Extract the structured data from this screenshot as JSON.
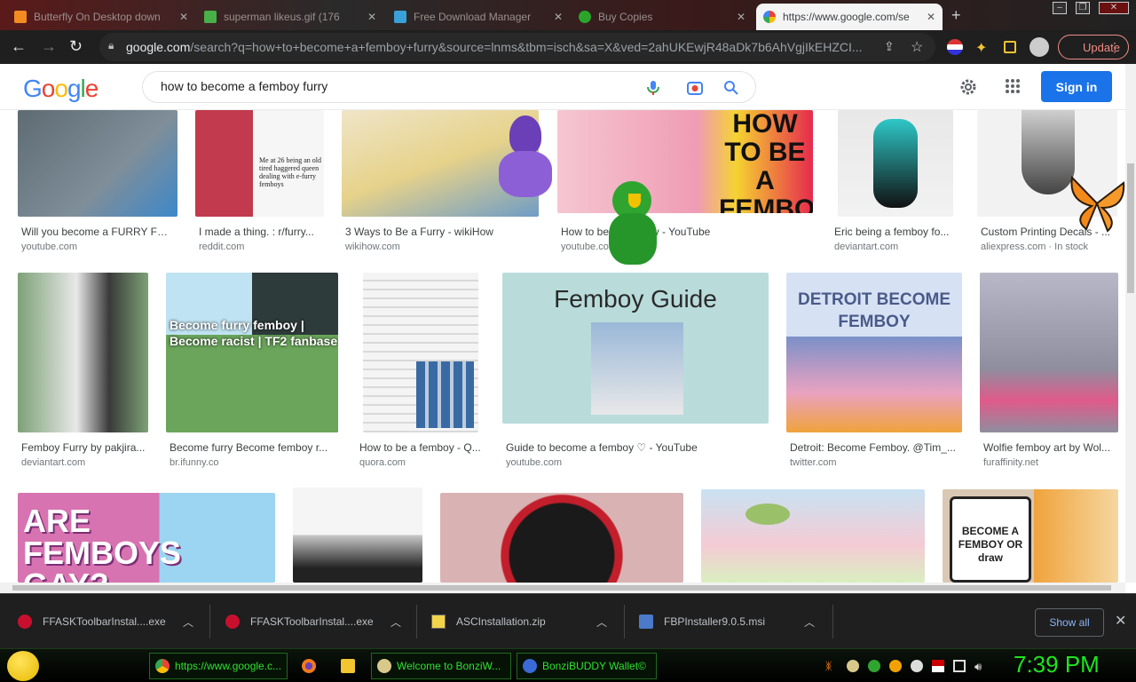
{
  "browser": {
    "tabs": [
      {
        "label": "Butterfly On Desktop down",
        "active": false
      },
      {
        "label": "superman likeus.gif (176",
        "active": false
      },
      {
        "label": "Free Download Manager",
        "active": false
      },
      {
        "label": "Buy Copies",
        "active": false
      },
      {
        "label": "https://www.google.com/se",
        "active": true
      }
    ],
    "url_host": "google.com",
    "url_rest": "/search?q=how+to+become+a+femboy+furry&source=lnms&tbm=isch&sa=X&ved=2ahUKEwjR48aDk7b6AhVgjIkEHZCI...",
    "update_label": "Update"
  },
  "google": {
    "logo": "Google",
    "query": "how to become a femboy furry",
    "sign_in": "Sign in"
  },
  "results": [
    {
      "title": "Will you become a FURRY FE...",
      "source": "youtube.com",
      "colors": [
        "#3d88c9",
        "#7f8e99"
      ]
    },
    {
      "title": "I made a thing. : r/furry...",
      "source": "reddit.com",
      "caption": "Me at 26 being an old tired haggered queen dealing with e-furry femboys",
      "colors": [
        "#c23a4d",
        "#f6f6f6"
      ]
    },
    {
      "title": "3 Ways to Be a Furry - wikiHow",
      "source": "wikihow.com",
      "colors": [
        "#e6d28a",
        "#6f9cc6"
      ]
    },
    {
      "title": "How to be a Femboy - YouTube",
      "source": "youtube.com",
      "caption": "HOW TO BE A FEMBOY",
      "colors": [
        "#ef9cb4",
        "#f5d331"
      ]
    },
    {
      "title": "Eric being a femboy fo...",
      "source": "deviantart.com",
      "colors": [
        "#e8e8e8",
        "#2ec7c7"
      ]
    },
    {
      "title": "Custom Printing Decals - ...",
      "source": "aliexpress.com",
      "extra": "In stock",
      "colors": [
        "#f2f2f2",
        "#444444"
      ]
    },
    {
      "title": "Femboy Furry by pakjira...",
      "source": "deviantart.com",
      "colors": [
        "#7da177",
        "#e8e8e8"
      ]
    },
    {
      "title": "Become furry Become femboy r...",
      "source": "br.ifunny.co",
      "caption": "Become furry femboy | Become racist | TF2 fanbase",
      "colors": [
        "#6aa55b",
        "#2d3b3a"
      ]
    },
    {
      "title": "How to be a femboy - Q...",
      "source": "quora.com",
      "colors": [
        "#f4f4f4",
        "#3a6aa3"
      ]
    },
    {
      "title": "Guide to become a femboy ♡ - YouTube",
      "source": "youtube.com",
      "caption": "Femboy Guide",
      "colors": [
        "#b9dcdb",
        "#9ab8d8"
      ]
    },
    {
      "title": "Detroit: Become Femboy. @Tim_...",
      "source": "twitter.com",
      "caption": "DETROIT BECOME FEMBOY",
      "colors": [
        "#7b90c8",
        "#e9a2c0"
      ]
    },
    {
      "title": "Wolfie femboy art by Wol...",
      "source": "furaffinity.net",
      "colors": [
        "#8e8e9e",
        "#e05a8a"
      ]
    },
    {
      "title": "",
      "source": "",
      "caption": "ARE FEMBOYS GAY?",
      "colors": [
        "#d773b0",
        "#9bd5f2"
      ]
    },
    {
      "title": "",
      "source": "",
      "colors": [
        "#f5f5f5",
        "#c9c9c9"
      ]
    },
    {
      "title": "",
      "source": "",
      "colors": [
        "#1a1a1a",
        "#c21e2b"
      ]
    },
    {
      "title": "",
      "source": "",
      "colors": [
        "#c9e2f2",
        "#9ac06a"
      ]
    },
    {
      "title": "",
      "source": "",
      "caption": "BECOME A FEMBOY OR draw",
      "colors": [
        "#d9c8b4",
        "#f0a33c"
      ]
    }
  ],
  "downloads": [
    {
      "name": "FFASKToolbarInstal....exe"
    },
    {
      "name": "FFASKToolbarInstal....exe"
    },
    {
      "name": "ASCInstallation.zip"
    },
    {
      "name": "FBPInstaller9.0.5.msi"
    }
  ],
  "downloads_show_all": "Show all",
  "taskbar": {
    "items": [
      {
        "label": "https://www.google.c..."
      },
      {
        "label": ""
      },
      {
        "label": ""
      },
      {
        "label": "Welcome to BonziW..."
      },
      {
        "label": "BonziBUDDY Wallet©"
      }
    ],
    "clock": "7:39 PM"
  },
  "theme": {
    "accent": "#1a73e8",
    "taskbar_text": "#2fe02f"
  }
}
